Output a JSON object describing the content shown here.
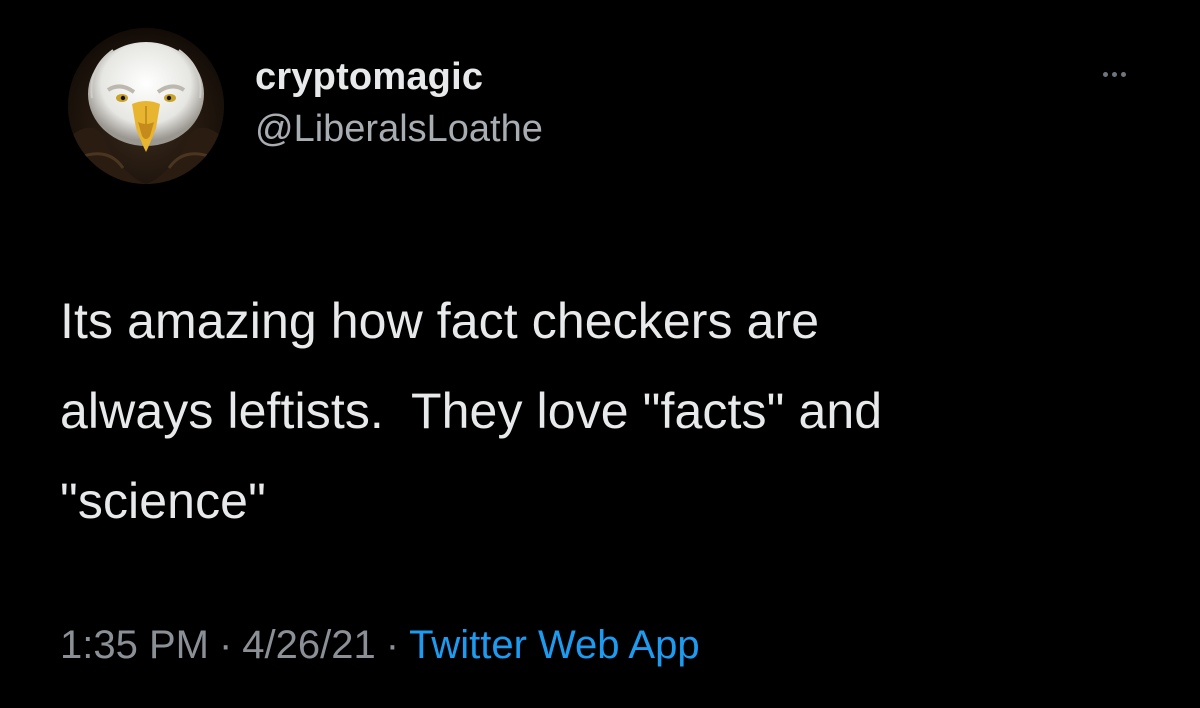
{
  "author": {
    "display_name": "cryptomagic",
    "handle": "@LiberalsLoathe",
    "avatar_icon": "bald-eagle-avatar"
  },
  "tweet": {
    "text": "Its amazing how fact checkers are\nalways leftists.  They love \"facts\" and\n\"science\""
  },
  "meta": {
    "time": "1:35 PM",
    "date": "4/26/21",
    "separator": "·",
    "source": "Twitter Web App"
  },
  "actions": {
    "more_icon": "more-options-icon"
  },
  "colors": {
    "background": "#000000",
    "primary_text": "#e7e9ea",
    "secondary_text": "#8b9096",
    "link": "#1d9bf0"
  }
}
